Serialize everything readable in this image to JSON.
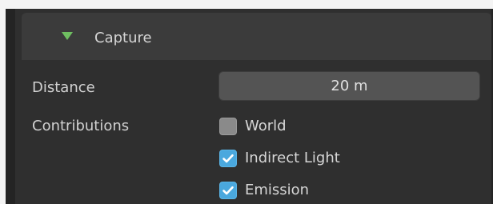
{
  "panel": {
    "title": "Capture",
    "expanded": true,
    "icon": "triangle-down-icon",
    "accent_color": "#6fbf61"
  },
  "distance": {
    "label": "Distance",
    "value": "20 m"
  },
  "contributions": {
    "label": "Contributions",
    "items": [
      {
        "label": "World",
        "checked": false
      },
      {
        "label": "Indirect Light",
        "checked": true
      },
      {
        "label": "Emission",
        "checked": true
      }
    ],
    "checked_color": "#4aa8de"
  }
}
